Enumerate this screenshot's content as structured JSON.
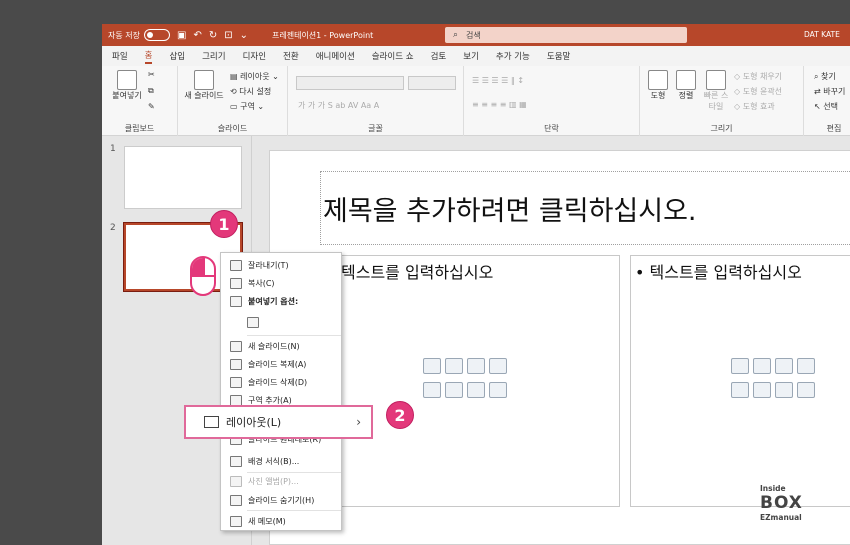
{
  "titlebar": {
    "autosave_label": "자동 저장",
    "toggle_state": "끔",
    "doc_title": "프레젠테이션1 - PowerPoint",
    "search_placeholder": "검색",
    "user": "DAT KATE"
  },
  "tabs": [
    "파일",
    "홈",
    "삽입",
    "그리기",
    "디자인",
    "전환",
    "애니메이션",
    "슬라이드 쇼",
    "검토",
    "보기",
    "추가 기능",
    "도움말"
  ],
  "active_tab": "홈",
  "ribbon": {
    "clipboard": {
      "paste": "붙여넣기",
      "label": "클립보드"
    },
    "slides": {
      "new_slide": "새 슬라이드",
      "layout": "레이아웃",
      "reset": "다시 설정",
      "section": "구역",
      "label": "슬라이드"
    },
    "font": {
      "label": "글꼴"
    },
    "paragraph": {
      "label": "단락"
    },
    "drawing": {
      "shape": "도형",
      "arrange": "정렬",
      "quick_style": "빠른 스타일",
      "fill": "도형 채우기",
      "outline": "도형 윤곽선",
      "effect": "도형 효과",
      "label": "그리기"
    },
    "editing": {
      "find": "찾기",
      "replace": "바꾸기",
      "select": "선택",
      "label": "편집"
    }
  },
  "thumbnails": [
    {
      "num": "1"
    },
    {
      "num": "2"
    }
  ],
  "slide": {
    "title_placeholder": "제목을 추가하려면 클릭하십시오.",
    "body_left": "텍스트를 입력하십시오",
    "body_right": "• 텍스트를 입력하십시오"
  },
  "context_menu": {
    "cut": "잘라내기(T)",
    "copy": "복사(C)",
    "paste_options": "붙여넣기 옵션:",
    "new_slide": "새 슬라이드(N)",
    "duplicate": "슬라이드 복제(A)",
    "delete": "슬라이드 삭제(D)",
    "add_section": "구역 추가(A)",
    "layout": "레이아웃(L)",
    "reset": "슬라이드 원래대로(R)",
    "format_bg": "배경 서식(B)...",
    "photo_album": "사진 앨범(P)...",
    "hide": "슬라이드 숨기기(H)",
    "new_comment": "새 메모(M)"
  },
  "callouts": [
    "1",
    "2"
  ],
  "watermark": {
    "top": "Inside",
    "main": "BOX",
    "bottom": "EZmanual"
  },
  "colors": {
    "accent": "#b7472a",
    "callout": "#e3387a"
  }
}
